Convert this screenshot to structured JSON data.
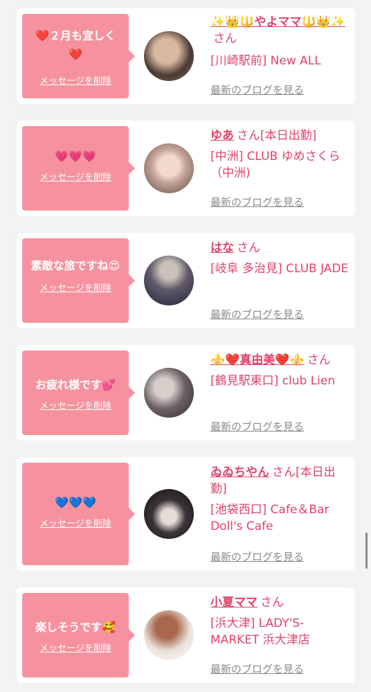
{
  "delete_label": "メッセージを削除",
  "blog_label": "最新のブログを見る",
  "colors": {
    "bubble": "#f6929f",
    "name": "#e0436a",
    "link_gray": "#8a8a8a",
    "background": "#f3f3f4"
  },
  "cards": [
    {
      "message": "❤️２月も宜しく❤️",
      "name": "✨👑🔱やよママ🔱👑✨",
      "suffix": "さん",
      "store": "[川崎駅前] New ALL"
    },
    {
      "message": "💗💗💗",
      "name": "ゆあ",
      "suffix": "さん[本日出勤]",
      "store": "[中洲] CLUB ゆめさくら（中洲)"
    },
    {
      "message": "素敵な旅ですね😍",
      "name": "はな",
      "suffix": "さん",
      "store": "[岐阜 多治見] CLUB JADE"
    },
    {
      "message": "お疲れ様です💕",
      "name": "⚜️❤️真由美❤️⚜️",
      "suffix": "さん",
      "store": "[鶴見駅東口] club Lien"
    },
    {
      "message": "💙💙💙",
      "name": "ゐゐちやん",
      "suffix": "さん[本日出勤]",
      "store": "[池袋西口] Cafe＆Bar Doll's Cafe"
    },
    {
      "message": "楽しそうです🥰",
      "name": "小夏ママ",
      "suffix": "さん",
      "store": "[浜大津] LADY'S-MARKET 浜大津店"
    }
  ]
}
